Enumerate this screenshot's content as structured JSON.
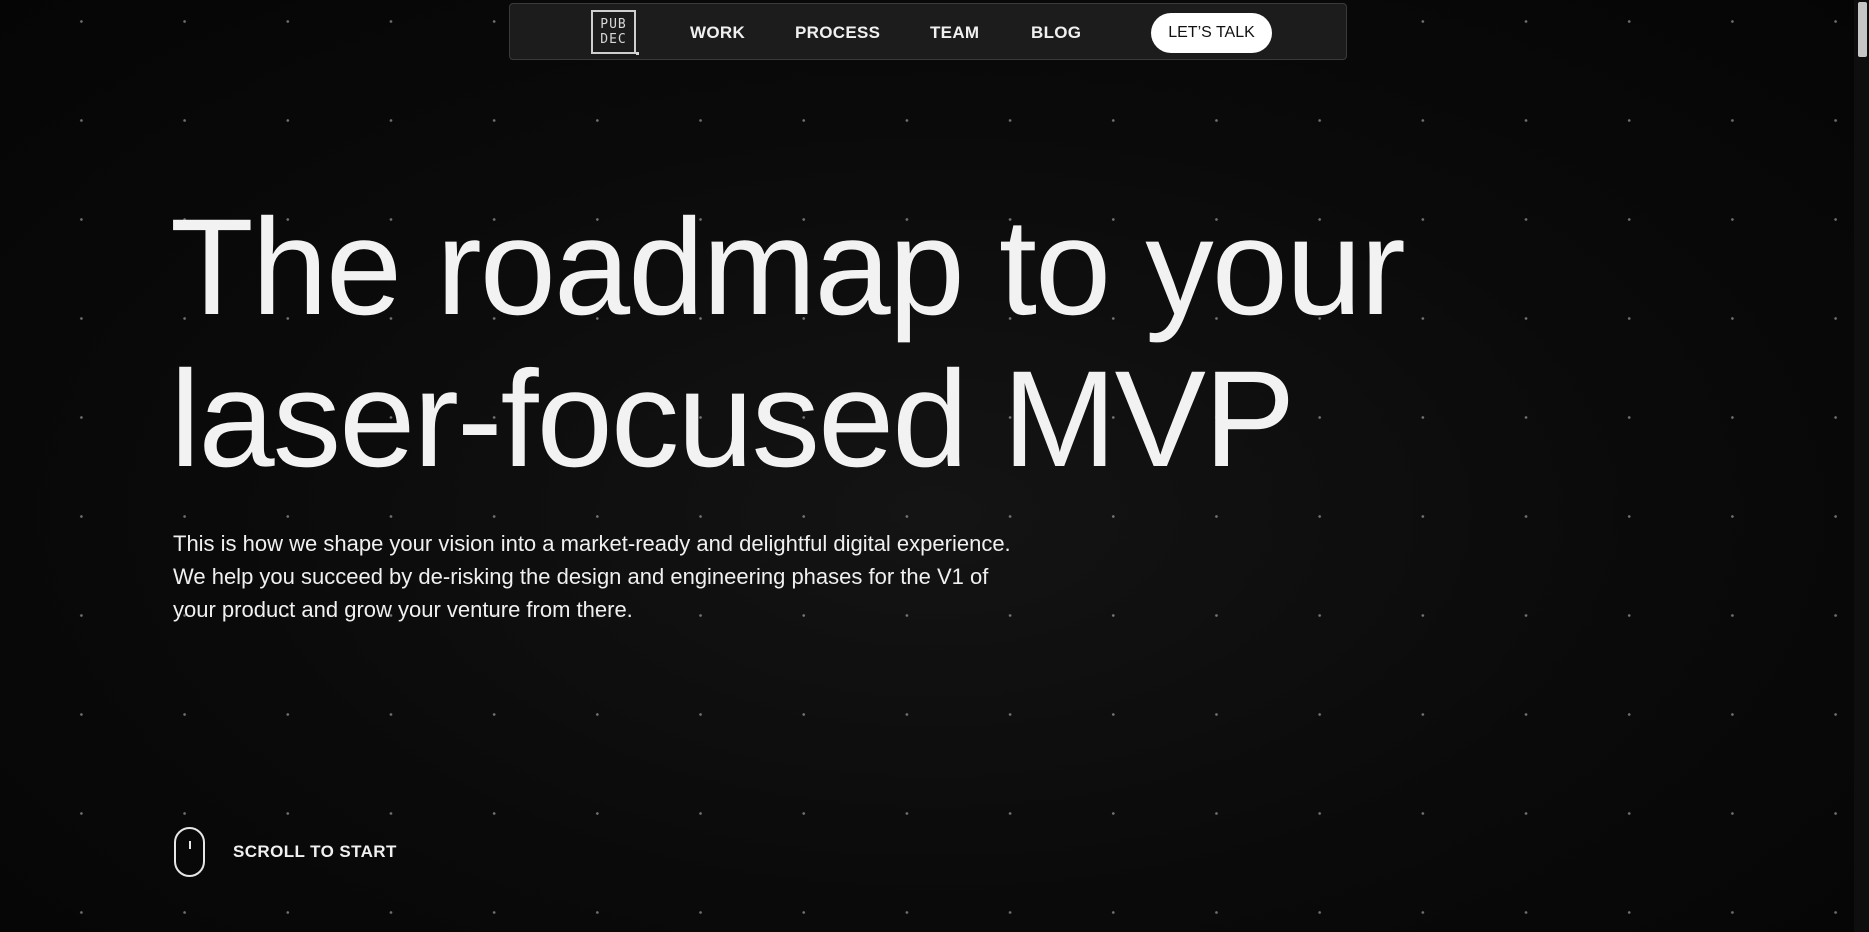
{
  "nav": {
    "logo_line1": "PUB",
    "logo_line2": "DEC",
    "links": [
      {
        "label": "WORK"
      },
      {
        "label": "PROCESS"
      },
      {
        "label": "TEAM"
      },
      {
        "label": "BLOG"
      }
    ],
    "cta_label": "LET’S TALK"
  },
  "hero": {
    "headline_line1": "The roadmap to your",
    "headline_line2": "laser-focused MVP",
    "subtext_line1": "This is how we shape your vision into a market-ready and delightful digital experience.",
    "subtext_line2": "We help you succeed by de-risking the design and engineering phases for the V1 of",
    "subtext_line3": "your product and grow your venture from there."
  },
  "scroll": {
    "icon": "mouse-icon",
    "label": "SCROLL TO START"
  },
  "colors": {
    "background": "#0b0b0b",
    "text": "#f2f2f2",
    "nav_background": "#1c1c1c",
    "cta_background": "#ffffff",
    "cta_text": "#111111"
  }
}
